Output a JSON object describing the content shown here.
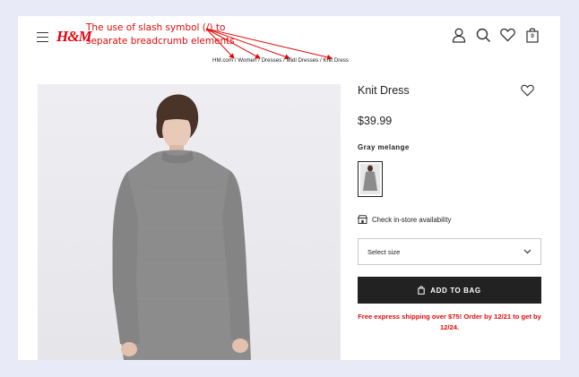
{
  "brand": {
    "logo_text": "H&M",
    "color": "#e50010"
  },
  "annotation": {
    "text": "The use of slash symbol (/) to separate breadcrumb elements",
    "color": "#e10a0a"
  },
  "breadcrumb": {
    "items": [
      "HM.com",
      "Women",
      "Dresses",
      "Midi Dresses",
      "Knit Dress"
    ],
    "separator": " / ",
    "full_text": "HM.com / Women / Dresses / Midi Dresses / Knit Dress"
  },
  "header": {
    "icons": [
      "menu-icon",
      "account-icon",
      "search-icon",
      "heart-icon",
      "bag-icon"
    ],
    "bag_count": "0"
  },
  "product": {
    "title": "Knit Dress",
    "price": "$39.99",
    "color_name": "Gray melange",
    "store_check": "Check in-store availability",
    "size_placeholder": "Select size",
    "add_button": "ADD TO BAG",
    "shipping_note": "Free express shipping over $75! Order by 12/21 to get by 12/24."
  }
}
